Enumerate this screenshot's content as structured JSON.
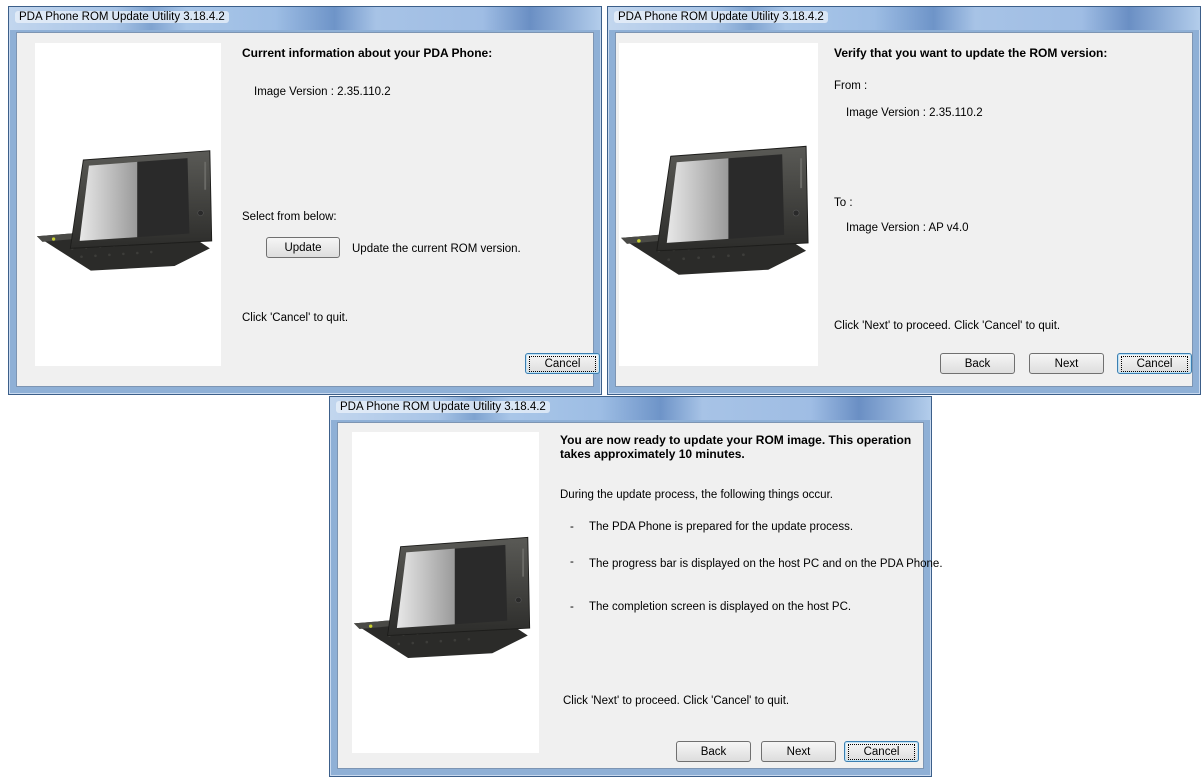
{
  "windows": [
    {
      "title": "PDA Phone ROM Update Utility 3.18.4.2",
      "heading": "Current information about your PDA Phone:",
      "image_version": "Image Version : 2.35.110.2",
      "select_label": "Select from below:",
      "update_button": "Update",
      "update_desc": "Update the current ROM version.",
      "instruction": "Click 'Cancel' to quit.",
      "cancel_button": "Cancel"
    },
    {
      "title": "PDA Phone ROM Update Utility 3.18.4.2",
      "heading": "Verify that you want to update the ROM version:",
      "from_label": "From :",
      "from_version": "Image Version : 2.35.110.2",
      "to_label": "To :",
      "to_version": "Image Version : AP v4.0",
      "instruction": "Click 'Next' to proceed. Click 'Cancel' to quit.",
      "back_button": "Back",
      "next_button": "Next",
      "cancel_button": "Cancel"
    },
    {
      "title": "PDA Phone ROM Update Utility 3.18.4.2",
      "heading_line1": "You are now ready to update your ROM image. This operation",
      "heading_line2": "takes approximately 10 minutes.",
      "intro": "During the update process, the following things occur.",
      "bullets": [
        "The PDA Phone is prepared for the update process.",
        "The progress bar is displayed on the host PC and on the PDA Phone.",
        "The completion screen is displayed on the host PC."
      ],
      "bullet_mark": "-",
      "instruction": "Click 'Next' to proceed. Click 'Cancel' to quit.",
      "back_button": "Back",
      "next_button": "Next",
      "cancel_button": "Cancel"
    }
  ],
  "colors": {
    "title_bar": "#a8c4e6",
    "dialog_bg": "#f0f0f0",
    "device_body": "#3a3a38"
  }
}
